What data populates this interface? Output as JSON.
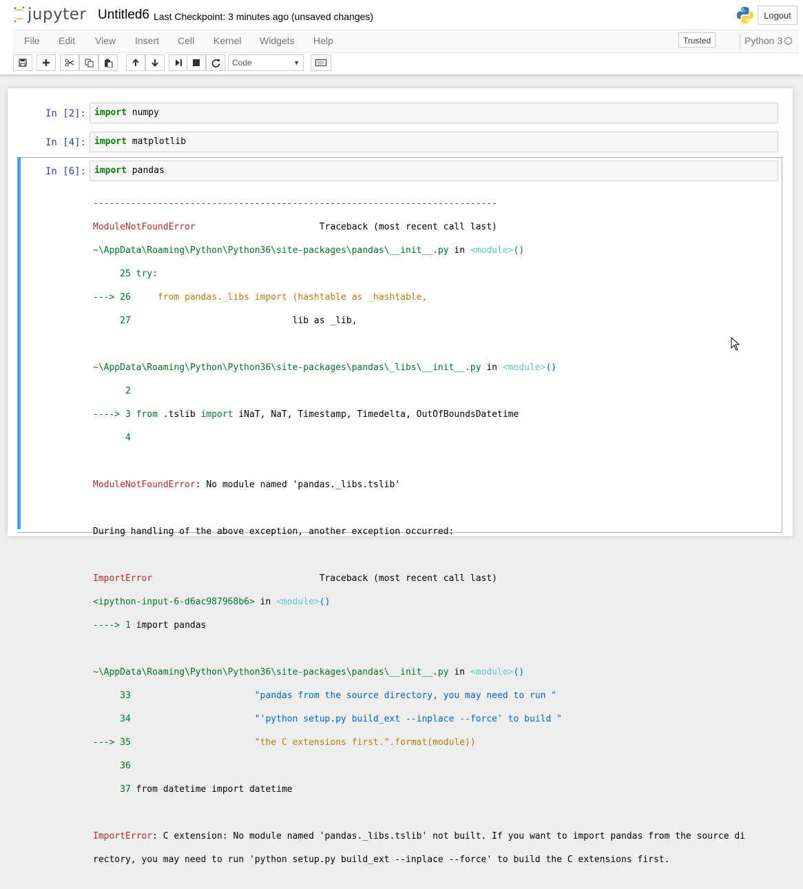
{
  "app": {
    "logo_text": "jupyter",
    "notebook_title": "Untitled6",
    "checkpoint": "Last Checkpoint: 3 minutes ago (unsaved changes)",
    "logout_label": "Logout"
  },
  "menu": {
    "items": [
      "File",
      "Edit",
      "View",
      "Insert",
      "Cell",
      "Kernel",
      "Widgets",
      "Help"
    ],
    "trusted_label": "Trusted",
    "kernel_name": "Python 3"
  },
  "toolbar": {
    "buttons": [
      "save-icon",
      "plus-icon",
      "cut-icon",
      "copy-icon",
      "paste-icon",
      "arrow-up-icon",
      "arrow-down-icon",
      "step-forward-icon",
      "stop-icon",
      "restart-icon",
      "keyboard-icon"
    ],
    "cell_type": "Code"
  },
  "cells": [
    {
      "prompt": "In [2]:",
      "keyword": "import",
      "rest": " numpy"
    },
    {
      "prompt": "In [4]:",
      "keyword": "import",
      "rest": " matplotlib"
    },
    {
      "prompt": "In [6]:",
      "keyword": "import",
      "rest": " pandas"
    }
  ],
  "output": {
    "l01": "---------------------------------------------------------------------------",
    "l02a": "ModuleNotFoundError",
    "l02b": "                       Traceback (most recent call last)",
    "l03a": "~\\AppData\\Roaming\\Python\\Python36\\site-packages\\pandas\\__init__.py",
    "l03b": " in ",
    "l03c": "<module>",
    "l03d": "()",
    "l04a": "     25 ",
    "l04b": "try:",
    "l05a": "---> 26 ",
    "l05b": "    from pandas._libs import (hashtable as _hashtable,",
    "l06a": "     27 ",
    "l06b": "                             lib as _lib,",
    "l08a": "~\\AppData\\Roaming\\Python\\Python36\\site-packages\\pandas\\_libs\\__init__.py",
    "l08b": " in ",
    "l08c": "<module>",
    "l08d": "()",
    "l09a": "      2",
    "l10a": "----> 3 ",
    "l10b": "from",
    "l10c": " .tslib ",
    "l10d": "import",
    "l10e": " iNaT, NaT, Timestamp, Timedelta, OutOfBoundsDatetime",
    "l11a": "      4",
    "l13a": "ModuleNotFoundError",
    "l13b": ": No module named 'pandas._libs.tslib'",
    "l15": "During handling of the above exception, another exception occurred:",
    "l17a": "ImportError",
    "l17b": "                               Traceback (most recent call last)",
    "l18a": "<ipython-input-6-d6ac987968b6>",
    "l18b": " in ",
    "l18c": "<module>",
    "l18d": "()",
    "l19a": "----> 1 ",
    "l19b": "import pandas",
    "l21a": "~\\AppData\\Roaming\\Python\\Python36\\site-packages\\pandas\\__init__.py",
    "l21b": " in ",
    "l21c": "<module>",
    "l21d": "()",
    "l22a": "     33 ",
    "l22b": "                      \"pandas from the source directory, you may need to run \"",
    "l23a": "     34 ",
    "l23b": "                      \"'python setup.py build_ext --inplace --force' to build \"",
    "l24a": "---> 35 ",
    "l24b": "                      \"the C extensions first.\".format(module))",
    "l25a": "     36",
    "l26a": "     37 ",
    "l26b": "from datetime import datetime",
    "l28a": "ImportError",
    "l28b": ": C extension: No module named 'pandas._libs.tslib' not built. If you want to import pandas from the source di",
    "l29": "rectory, you may need to run 'python setup.py build_ext --inplace --force' to build the C extensions first."
  }
}
